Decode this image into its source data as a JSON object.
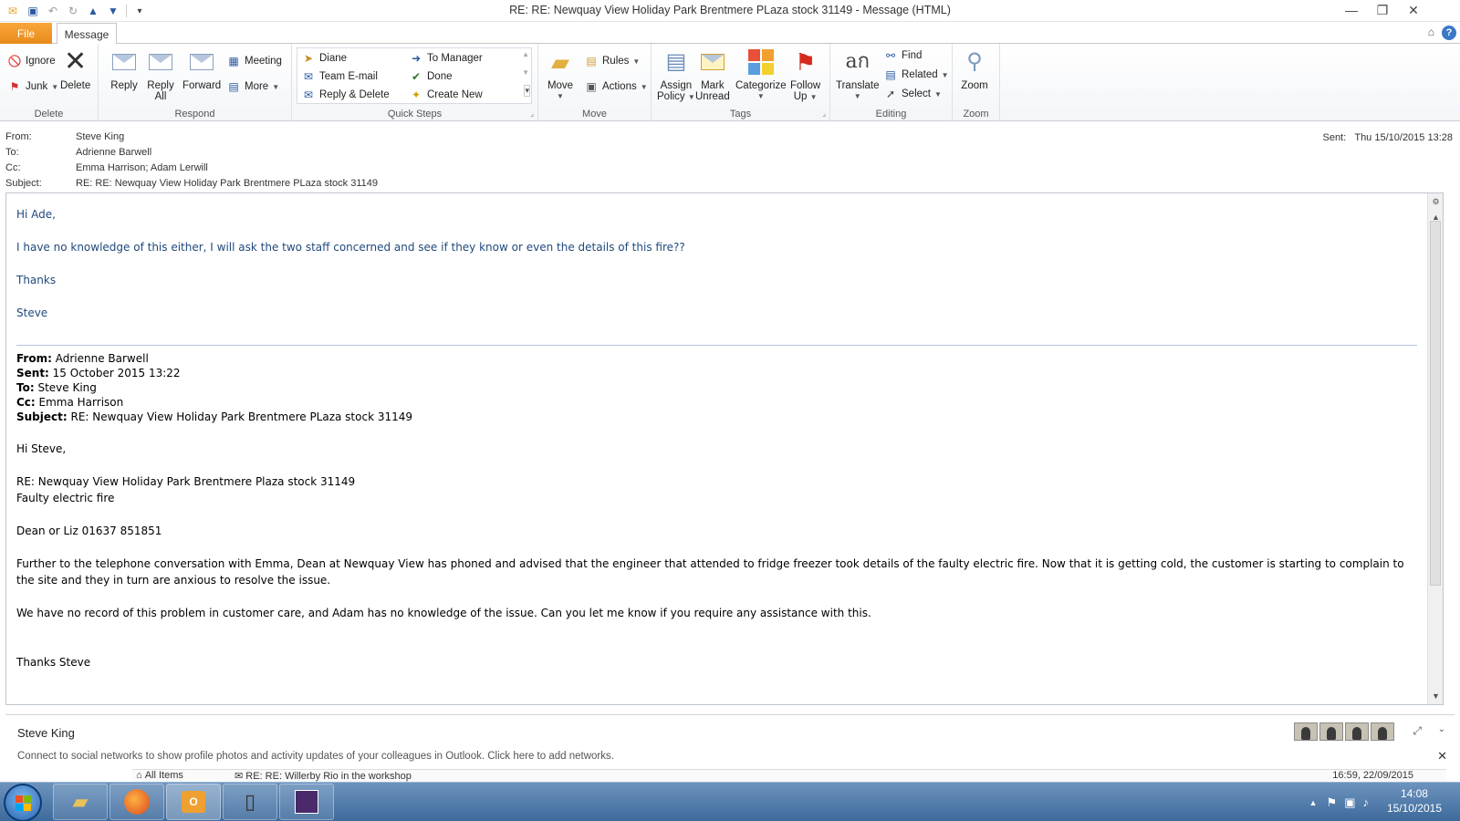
{
  "window": {
    "title": "RE: RE: Newquay View Holiday Park Brentmere PLaza stock 31149  -  Message (HTML)"
  },
  "tabs": {
    "file": "File",
    "message": "Message"
  },
  "ribbon": {
    "delete_group": {
      "label": "Delete",
      "ignore": "Ignore",
      "junk": "Junk",
      "delete": "Delete"
    },
    "respond_group": {
      "label": "Respond",
      "reply": "Reply",
      "reply_all_1": "Reply",
      "reply_all_2": "All",
      "forward": "Forward",
      "meeting": "Meeting",
      "more": "More"
    },
    "quick_steps": {
      "label": "Quick Steps",
      "items": [
        "Diane",
        "Team E-mail",
        "Reply & Delete",
        "To Manager",
        "Done",
        "Create New"
      ]
    },
    "move_group": {
      "label": "Move",
      "move": "Move",
      "rules": "Rules",
      "actions": "Actions"
    },
    "tags_group": {
      "label": "Tags",
      "assign_1": "Assign",
      "assign_2": "Policy",
      "mark_1": "Mark",
      "mark_2": "Unread",
      "categorize": "Categorize",
      "follow_1": "Follow",
      "follow_2": "Up"
    },
    "editing_group": {
      "label": "Editing",
      "translate": "Translate",
      "find": "Find",
      "related": "Related",
      "select": "Select"
    },
    "zoom_group": {
      "label": "Zoom",
      "zoom": "Zoom"
    }
  },
  "header": {
    "from_label": "From:",
    "from": "Steve King",
    "to_label": "To:",
    "to": "Adrienne Barwell",
    "cc_label": "Cc:",
    "cc": "Emma Harrison; Adam Lerwill",
    "subject_label": "Subject:",
    "subject": "RE: RE: Newquay View Holiday Park Brentmere PLaza stock 31149",
    "sent_label": "Sent:",
    "sent": "Thu 15/10/2015 13:28"
  },
  "body": {
    "reply": {
      "greeting": "Hi Ade,",
      "line1": "I have no knowledge of this either, I will ask the two staff concerned and see if they know or even the details of this fire??",
      "thanks": "Thanks",
      "sign": "Steve"
    },
    "quoted_header": {
      "from_label": "From:",
      "from": " Adrienne Barwell",
      "sent_label": "Sent:",
      "sent": " 15 October 2015 13:22",
      "to_label": "To:",
      "to": " Steve King",
      "cc_label": "Cc:",
      "cc": " Emma Harrison",
      "subject_label": "Subject:",
      "subject": " RE: Newquay View Holiday Park Brentmere PLaza stock 31149"
    },
    "quoted": {
      "greeting": "Hi Steve,",
      "ref1": "RE: Newquay View Holiday Park Brentmere Plaza stock 31149",
      "ref2": "Faulty electric fire",
      "contact": "Dean or Liz 01637 851851",
      "para1": "Further to the telephone conversation with Emma,  Dean at Newquay View has phoned and advised that the engineer that attended to fridge freezer took details of the faulty electric fire.  Now that it is getting cold, the customer is starting to complain to the site and they in turn are anxious to resolve the issue.",
      "para2": "We have no record of this problem in customer care,  and Adam has no knowledge of the issue.  Can you let me know if you require any assistance with this.",
      "sign": "Thanks Steve"
    }
  },
  "people_pane": {
    "name": "Steve King",
    "social": "Connect to social networks to show profile photos and activity updates of your colleagues in Outlook. Click here to add networks."
  },
  "lower_list": {
    "folder": "All Items",
    "item": "RE: RE: Willerby Rio in the workshop",
    "date": "16:59, 22/09/2015"
  },
  "taskbar": {
    "time": "14:08",
    "date": "15/10/2015"
  }
}
